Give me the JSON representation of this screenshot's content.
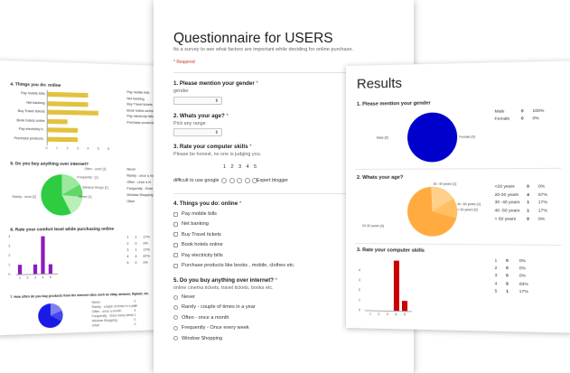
{
  "left_sheet": {
    "q4": {
      "title": "4. Things you do: online",
      "bars": [
        "Pay mobile bills",
        "Net banking",
        "Buy Travel tickets",
        "Book hotels online",
        "Pay electricity b..",
        "Purchase products.."
      ],
      "values": [
        4,
        4,
        5,
        2,
        3,
        3
      ],
      "ticks": [
        "0",
        "1",
        "2",
        "3",
        "4",
        "5",
        "6"
      ],
      "legend": [
        "Pay mobile bills",
        "Net banking",
        "Buy Travel tickets",
        "Book hotels online",
        "Pay electricity bills",
        "Purchase products"
      ]
    },
    "q5": {
      "title": "5. Do you buy anything over internet?",
      "slice_labels": [
        "Often - once [1]",
        "Frequently - [1]",
        "Window Shopp [1]",
        "Never [1]",
        "Rarely - once [2]"
      ],
      "legend": [
        "Never",
        "Rarely - once a month",
        "Often - once a m",
        "Frequently - Once a",
        "Window Shopping",
        "Other"
      ]
    },
    "q6": {
      "title": "6. Rate your comfort level while purchasing online",
      "ticks_x": [
        "1",
        "2",
        "3",
        "4",
        "5"
      ],
      "ticks_y": [
        "4",
        "3",
        "2",
        "1",
        "0"
      ],
      "values": [
        1,
        0,
        1,
        4,
        1
      ],
      "table": [
        [
          "1",
          "1",
          "17%"
        ],
        [
          "2",
          "0",
          "0%"
        ],
        [
          "3",
          "1",
          "17%"
        ],
        [
          "4",
          "4",
          "67%"
        ],
        [
          "5",
          "0",
          "0%"
        ]
      ]
    },
    "q7": {
      "title": "7. How often do you buy products from the internet sites such as ebay, amazon, flipkart, etc.",
      "legend": [
        "Never",
        "Rarely - couple of times in a year",
        "Often - once a month",
        "Frequently - Once every week",
        "Window Shopping",
        "Other"
      ],
      "counts": [
        "0",
        "1",
        "4",
        "1",
        "0",
        "0"
      ]
    },
    "colors": {
      "bar": "#e2c23e",
      "purple": "#8c1bbf",
      "green": "#2ecc40",
      "blue": "#1a1ae6"
    }
  },
  "form": {
    "title": "Questionnaire for USERS",
    "description": "Its a survey to see what factors are important while deciding for online purchase.",
    "required": "* Required",
    "q1": {
      "label": "1. Please mention your gender",
      "hint": "gender",
      "select": ""
    },
    "q2": {
      "label": "2. Whats your age?",
      "hint": "Pick any range",
      "select": ""
    },
    "q3": {
      "label": "3. Rate your computer skills",
      "hint": "Please be honest, no one is judging you.",
      "scale": [
        "1",
        "2",
        "3",
        "4",
        "5"
      ],
      "low": "difficult to use google",
      "high": "Expert blogger"
    },
    "q4": {
      "label": "4. Things you do: online",
      "options": [
        "Pay mobile bills",
        "Net banking",
        "Buy Travel tickets",
        "Book hotels online",
        "Pay electricity bills",
        "Purchase products like books , mobile, clothes etc."
      ]
    },
    "q5": {
      "label": "5. Do you buy anything over internet?",
      "hint": "online cinema tickets, travel tickets, books etc.",
      "options": [
        "Never",
        "Rarely - couple of times in a year",
        "Often - once a month",
        "Frequently - Once every week",
        "Window Shopping"
      ]
    },
    "star": "*"
  },
  "results": {
    "title": "Results",
    "q1": {
      "label": "1. Please mention your gender",
      "pie_labels": [
        "Male [0]",
        "Female [0]"
      ],
      "table": [
        [
          "Male",
          "0",
          "100%"
        ],
        [
          "Female",
          "0",
          "0%"
        ]
      ]
    },
    "q2": {
      "label": "2. Whats your age?",
      "pie_labels": [
        "30 -40 years [1]",
        "40 -50 years [1]",
        "> 50 years [0]",
        "20-30 years [4]"
      ],
      "table": [
        [
          "<20 years",
          "0",
          "0%"
        ],
        [
          "20-30 years",
          "4",
          "67%"
        ],
        [
          "30 -40 years",
          "1",
          "17%"
        ],
        [
          "40 -50 years",
          "1",
          "17%"
        ],
        [
          "> 50 years",
          "0",
          "0%"
        ]
      ]
    },
    "q3": {
      "label": "3. Rate your computer skills",
      "ticks_x": [
        "1",
        "2",
        "3",
        "4",
        "5"
      ],
      "ticks_y": [
        "4",
        "3",
        "2",
        "1",
        "0"
      ],
      "values": [
        0,
        0,
        0,
        5,
        1
      ],
      "table": [
        [
          "1",
          "0",
          "0%"
        ],
        [
          "2",
          "0",
          "0%"
        ],
        [
          "3",
          "0",
          "0%"
        ],
        [
          "4",
          "5",
          "83%"
        ],
        [
          "5",
          "1",
          "17%"
        ]
      ]
    },
    "colors": {
      "blue": "#0000cc",
      "orange": "#ffab40",
      "orange_light": "#ffd08a",
      "red": "#cc0000"
    }
  }
}
